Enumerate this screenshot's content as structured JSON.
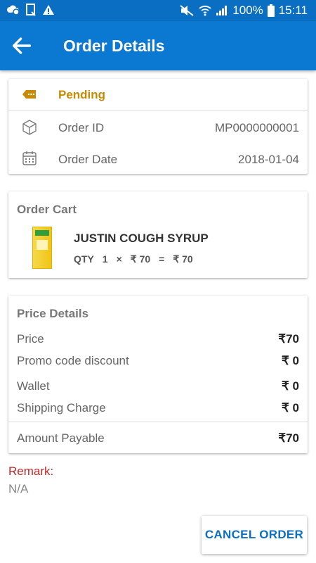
{
  "status_bar": {
    "battery": "100%",
    "time": "15:11"
  },
  "app_bar": {
    "title": "Order Details"
  },
  "order_info": {
    "status": "Pending",
    "order_id_label": "Order ID",
    "order_id": "MP0000000001",
    "order_date_label": "Order Date",
    "order_date": "2018-01-04"
  },
  "cart": {
    "heading": "Order Cart",
    "items": [
      {
        "name": "JUSTIN COUGH SYRUP",
        "qty_label": "QTY",
        "qty": "1",
        "times": "×",
        "unit_price": "₹ 70",
        "equals": "=",
        "total": "₹ 70"
      }
    ]
  },
  "price_details": {
    "heading": "Price Details",
    "rows": [
      {
        "label": "Price",
        "value": "₹70"
      },
      {
        "label": "Promo code discount",
        "value": "₹ 0"
      },
      {
        "label": "Wallet",
        "value": "₹ 0"
      },
      {
        "label": "Shipping Charge",
        "value": "₹ 0"
      }
    ],
    "total_label": "Amount Payable",
    "total_value": "₹70"
  },
  "remark": {
    "label": "Remark:",
    "value": "N/A"
  },
  "actions": {
    "cancel_label": "CANCEL ORDER"
  },
  "colors": {
    "primary": "#0b78d1",
    "pending": "#c88a00",
    "remark": "#c62828"
  }
}
